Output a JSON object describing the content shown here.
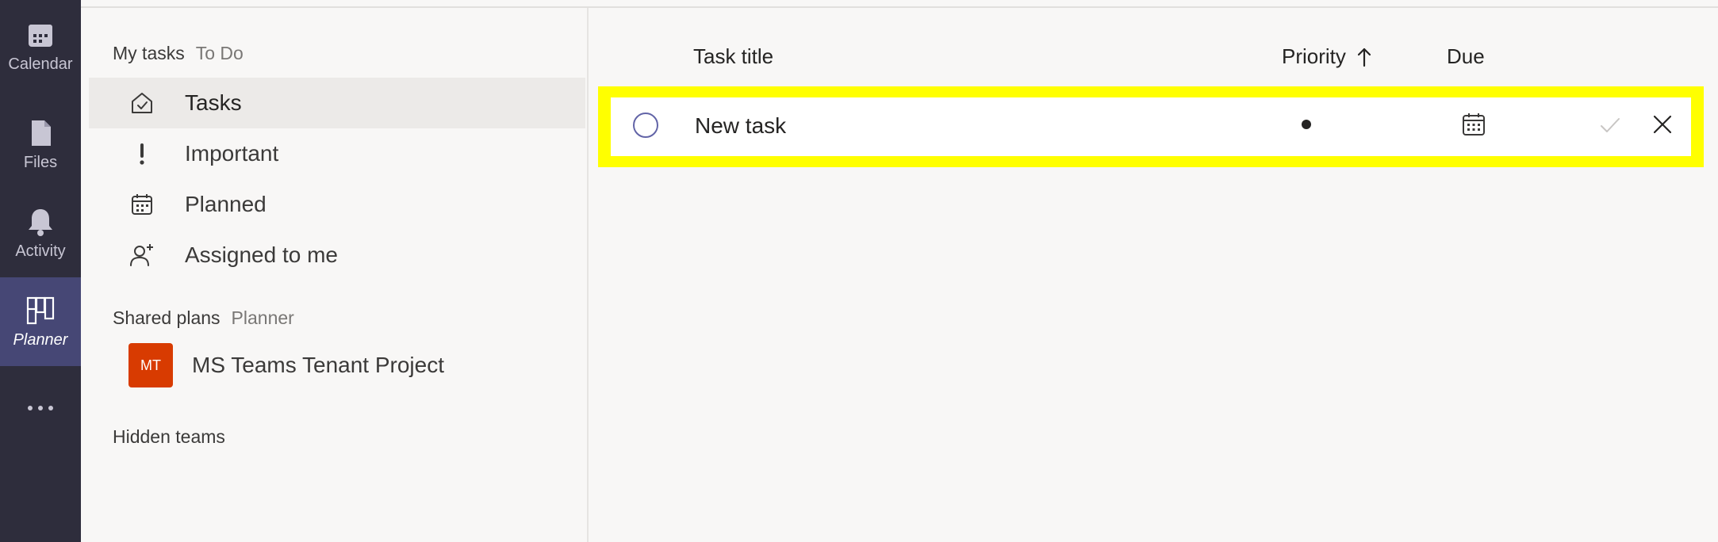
{
  "rail": {
    "items": [
      {
        "label": "Calendar",
        "icon": "calendar-icon"
      },
      {
        "label": "Files",
        "icon": "file-icon"
      },
      {
        "label": "Activity",
        "icon": "bell-icon"
      },
      {
        "label": "Planner",
        "icon": "planner-icon",
        "active": true
      }
    ],
    "more_icon": "more-horizontal-icon"
  },
  "nav": {
    "my_tasks": {
      "title": "My tasks",
      "source": "To Do"
    },
    "items": [
      {
        "label": "Tasks",
        "icon": "home-check-icon",
        "selected": true
      },
      {
        "label": "Important",
        "icon": "exclamation-icon"
      },
      {
        "label": "Planned",
        "icon": "calendar-icon"
      },
      {
        "label": "Assigned to me",
        "icon": "person-add-icon"
      }
    ],
    "shared_plans": {
      "title": "Shared plans",
      "source": "Planner"
    },
    "plans": [
      {
        "initials": "MT",
        "name": "MS Teams Tenant Project",
        "color": "#d83b01"
      }
    ],
    "hidden_teams": "Hidden teams"
  },
  "main": {
    "columns": {
      "title": "Task title",
      "priority": "Priority",
      "due": "Due"
    },
    "priority_sort_icon": "arrow-up-icon",
    "new_task": {
      "value": "New task"
    }
  },
  "colors": {
    "rail_bg": "#2e2d3c",
    "rail_active": "#464775",
    "accent": "#6264a7",
    "highlight": "#ffff00"
  }
}
